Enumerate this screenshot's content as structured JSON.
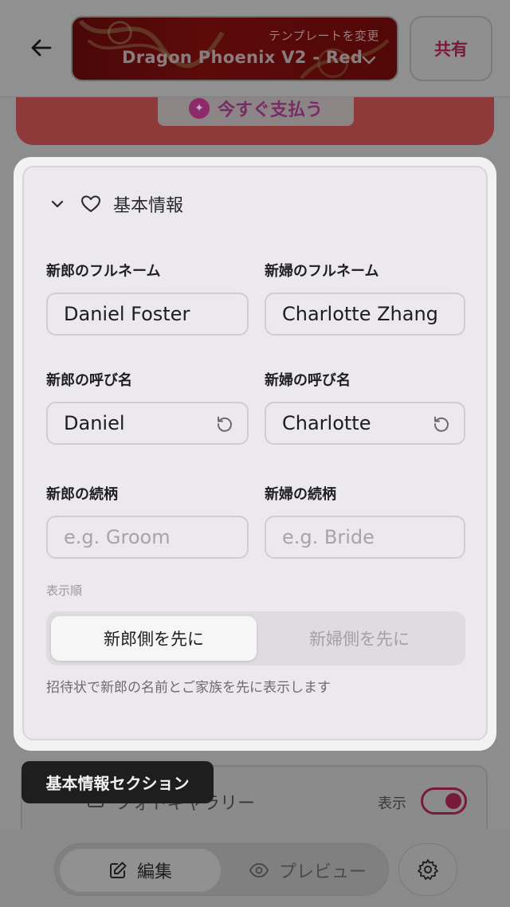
{
  "header": {
    "template_caption": "テンプレートを変更",
    "template_name": "Dragon Phoenix V2 - Red",
    "share_label": "共有"
  },
  "banner": {
    "pay_label": "今すぐ支払う"
  },
  "section": {
    "title": "基本情報",
    "groom_fullname_label": "新郎のフルネーム",
    "groom_fullname_value": "Daniel Foster",
    "bride_fullname_label": "新婦のフルネーム",
    "bride_fullname_value": "Charlotte Zhang",
    "groom_nickname_label": "新郎の呼び名",
    "groom_nickname_value": "Daniel",
    "bride_nickname_label": "新婦の呼び名",
    "bride_nickname_value": "Charlotte",
    "groom_relation_label": "新郎の続柄",
    "groom_relation_placeholder": "e.g. Groom",
    "bride_relation_label": "新婦の続柄",
    "bride_relation_placeholder": "e.g. Bride",
    "order_label": "表示順",
    "order_options": [
      "新郎側を先に",
      "新婦側を先に"
    ],
    "order_selected": "新郎側を先に",
    "helper_text": "招待状で新郎の名前とご家族を先に表示します"
  },
  "gallery": {
    "title": "フォトギャラリー",
    "show_label": "表示",
    "show_enabled": true
  },
  "tooltip": {
    "text": "基本情報セクション"
  },
  "bottom_nav": {
    "edit_label": "編集",
    "preview_label": "プレビュー",
    "active": "編集"
  },
  "colors": {
    "accent": "#d6185a",
    "overlay": "#8d8d8d",
    "card_bg": "#ebe9eb"
  }
}
